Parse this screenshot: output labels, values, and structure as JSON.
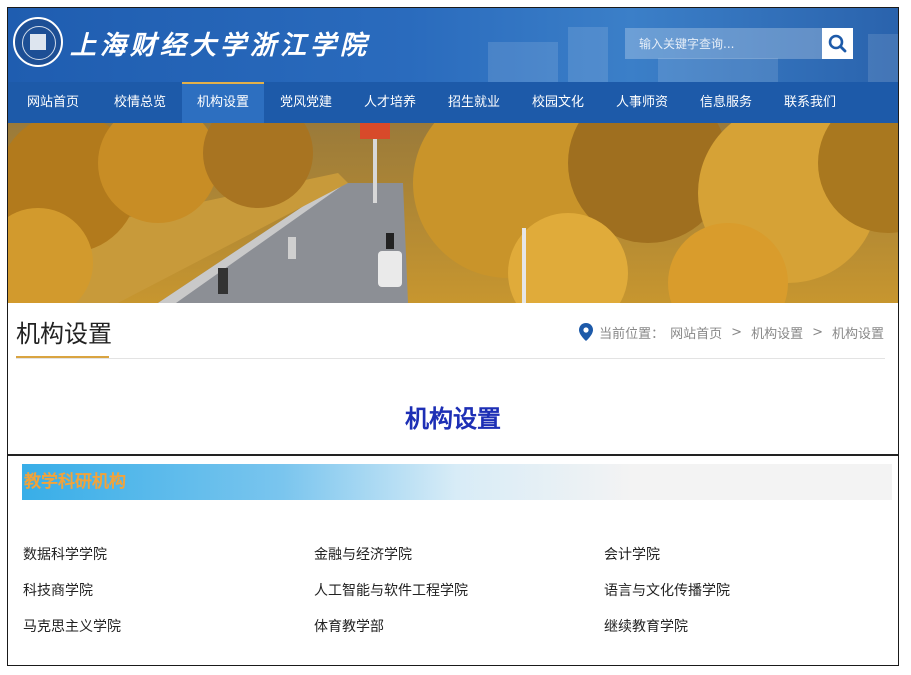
{
  "header": {
    "logo_text": "上海财经大学浙江学院",
    "search": {
      "placeholder": "输入关键字查询..."
    }
  },
  "nav": {
    "items": [
      "网站首页",
      "校情总览",
      "机构设置",
      "党风党建",
      "人才培养",
      "招生就业",
      "校园文化",
      "人事师资",
      "信息服务",
      "联系我们"
    ],
    "active_index": 2
  },
  "section": {
    "title": "机构设置",
    "breadcrumb": {
      "label": "当前位置：",
      "items": [
        "网站首页",
        "机构设置",
        "机构设置"
      ],
      "separator": ">"
    }
  },
  "page_heading": "机构设置",
  "category": {
    "title": "教学科研机构",
    "items": [
      [
        "数据科学学院",
        "金融与经济学院",
        "会计学院"
      ],
      [
        "科技商学院",
        "人工智能与软件工程学院",
        "语言与文化传播学院"
      ],
      [
        "马克思主义学院",
        "体育教学部",
        "继续教育学院"
      ]
    ]
  },
  "icons": {
    "logo": "university-emblem-icon",
    "search": "search-icon",
    "location": "map-pin-icon"
  },
  "colors": {
    "header_blue": "#1f5db0",
    "nav_blue": "#1d5aa9",
    "nav_active": "#2d6fc0",
    "accent_gold": "#d9a441",
    "heading_blue": "#1d2fb5",
    "category_orange": "#f2a33a"
  }
}
